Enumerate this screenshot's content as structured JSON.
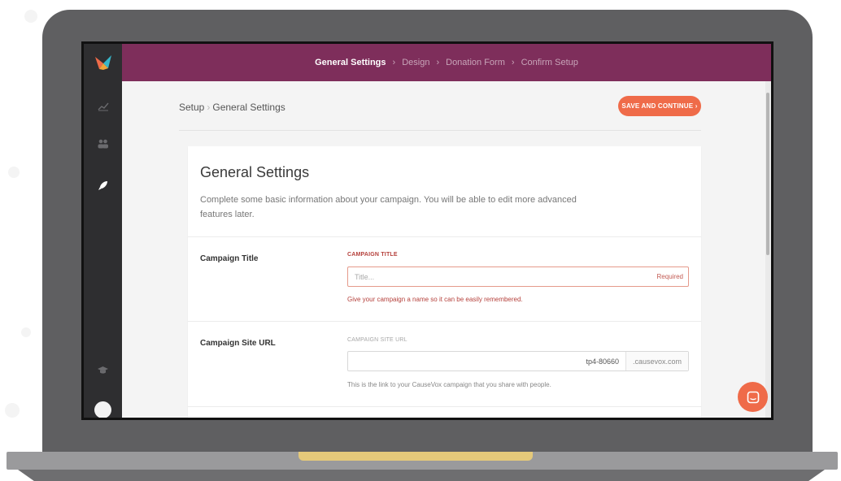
{
  "topbar": {
    "steps": [
      {
        "label": "General Settings"
      },
      {
        "label": "Design"
      },
      {
        "label": "Donation Form"
      },
      {
        "label": "Confirm Setup"
      }
    ],
    "separator": "›"
  },
  "breadcrumb": {
    "root": "Setup",
    "separator": "›",
    "current": "General Settings"
  },
  "actions": {
    "save_label": "SAVE AND CONTINUE ›"
  },
  "card": {
    "title": "General Settings",
    "description": "Complete some basic information about your campaign. You will be able to edit more advanced features later."
  },
  "fields": {
    "campaign_title": {
      "row_label": "Campaign Title",
      "field_label": "CAMPAIGN TITLE",
      "placeholder": "Title...",
      "value": "",
      "required_tag": "Required",
      "help": "Give your campaign a name so it can be easily remembered."
    },
    "campaign_url": {
      "row_label": "Campaign Site URL",
      "field_label": "CAMPAIGN SITE URL",
      "value": "tp4-80660",
      "suffix": ".causevox.com",
      "help": "This is the link to your CauseVox campaign that you share with people."
    }
  },
  "colors": {
    "topbar": "#7e2e5b",
    "accent": "#ef6b49",
    "sidebar": "#2e2e30",
    "error": "#b5413c"
  },
  "icons": {
    "sidebar": [
      "bird-logo-icon",
      "chart-icon",
      "people-icon",
      "rocket-icon",
      "graduation-cap-icon"
    ],
    "chat": "chat-icon"
  }
}
